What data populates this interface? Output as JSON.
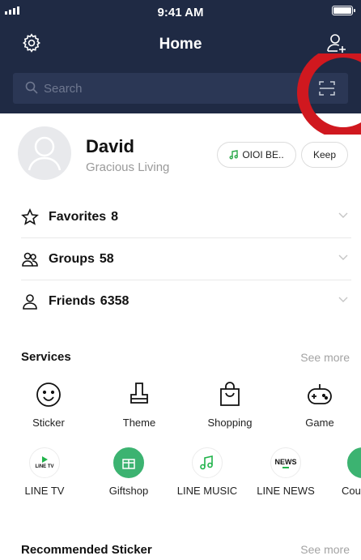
{
  "status_bar": {
    "time": "9:41 AM"
  },
  "header": {
    "title": "Home"
  },
  "search": {
    "placeholder": "Search"
  },
  "profile": {
    "name": "David",
    "status_message": "Gracious Living",
    "music_chip": "OIOI BE..",
    "keep_chip": "Keep"
  },
  "lists": [
    {
      "label": "Favorites",
      "count": "8"
    },
    {
      "label": "Groups",
      "count": "58"
    },
    {
      "label": "Friends",
      "count": "6358"
    }
  ],
  "services": {
    "title": "Services",
    "see_more": "See more",
    "items": [
      {
        "label": "Sticker",
        "icon": "smiley-icon"
      },
      {
        "label": "Theme",
        "icon": "brush-icon"
      },
      {
        "label": "Shopping",
        "icon": "shopping-bag-icon"
      },
      {
        "label": "Game",
        "icon": "gamepad-icon"
      }
    ],
    "apps": [
      {
        "label": "LINE TV",
        "icon_text": "LINE TV"
      },
      {
        "label": "Giftshop",
        "icon_text": ""
      },
      {
        "label": "LINE MUSIC",
        "icon_text": ""
      },
      {
        "label": "LINE NEWS",
        "icon_text": "NEWS"
      },
      {
        "label": "Cou",
        "icon_text": ""
      }
    ]
  },
  "recommended": {
    "title": "Recommended Sticker",
    "see_more": "See more"
  },
  "colors": {
    "header_bg": "#1f2a44",
    "search_bg": "#2b3755",
    "line_green": "#3cb371",
    "annotation_red": "#d0181f"
  }
}
